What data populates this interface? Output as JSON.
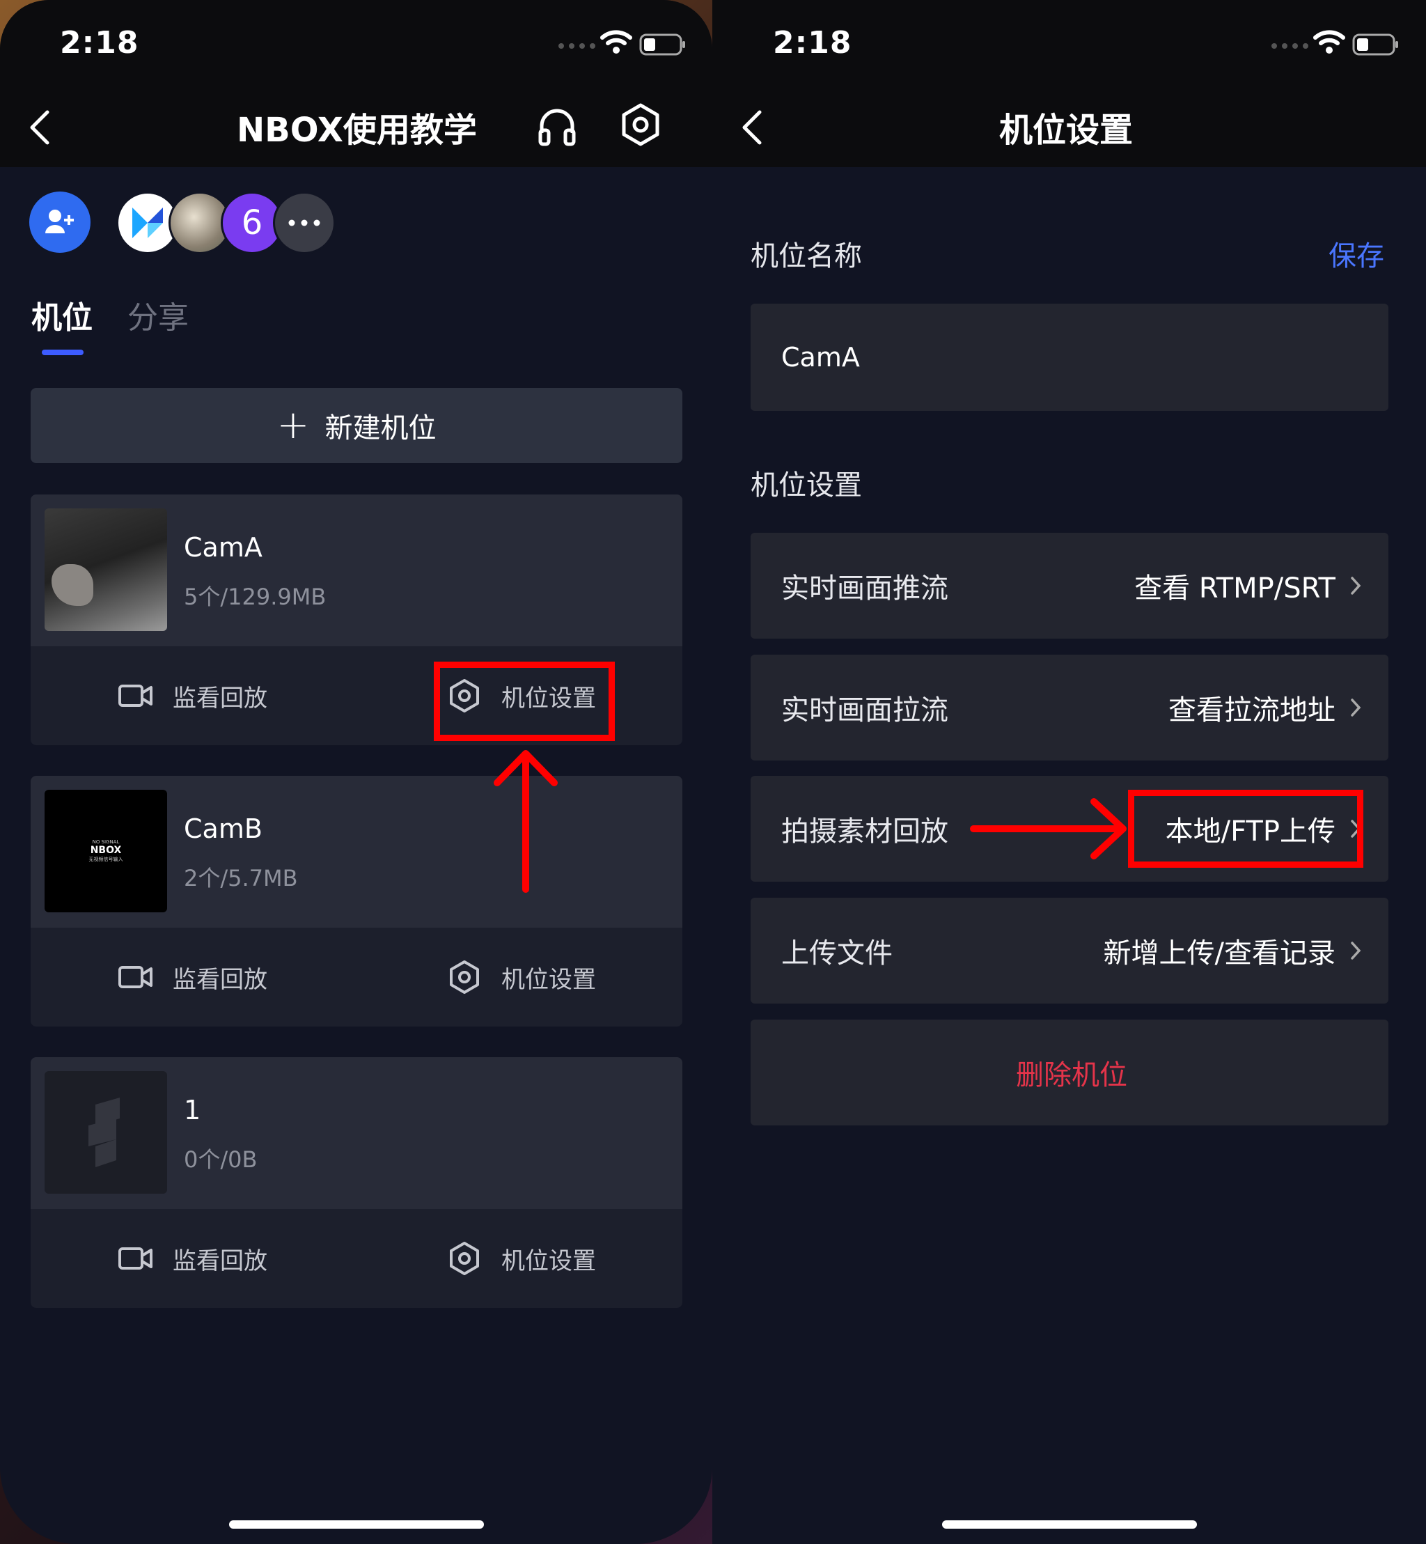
{
  "left_screen": {
    "status": {
      "time": "2:18"
    },
    "header": {
      "title": "NBOX使用教学"
    },
    "members": {
      "count_badge": "6"
    },
    "tabs": [
      {
        "label": "机位"
      },
      {
        "label": "分享"
      }
    ],
    "new_button": {
      "label": "新建机位"
    },
    "cameras": [
      {
        "name": "CamA",
        "meta": "5个/129.9MB",
        "monitor_label": "监看回放",
        "settings_label": "机位设置"
      },
      {
        "name": "CamB",
        "meta": "2个/5.7MB",
        "monitor_label": "监看回放",
        "settings_label": "机位设置",
        "thumb_text_1": "NO SIGNAL",
        "thumb_text_2": "NBOX",
        "thumb_text_3": "无视频信号输入"
      },
      {
        "name": "1",
        "meta": "0个/0B",
        "monitor_label": "监看回放",
        "settings_label": "机位设置"
      }
    ]
  },
  "right_screen": {
    "status": {
      "time": "2:18"
    },
    "header": {
      "title": "机位设置"
    },
    "name_section": {
      "label": "机位名称",
      "save_label": "保存",
      "value": "CamA"
    },
    "settings_section": {
      "label": "机位设置"
    },
    "rows": [
      {
        "label": "实时画面推流",
        "value": "查看 RTMP/SRT"
      },
      {
        "label": "实时画面拉流",
        "value": "查看拉流地址"
      },
      {
        "label": "拍摄素材回放",
        "value": "本地/FTP上传"
      },
      {
        "label": "上传文件",
        "value": "新增上传/查看记录"
      }
    ],
    "delete_label": "删除机位"
  },
  "colors": {
    "accent": "#3d5cff",
    "link": "#4a76ff",
    "danger": "#e5344a",
    "annotation": "#ff0000"
  }
}
